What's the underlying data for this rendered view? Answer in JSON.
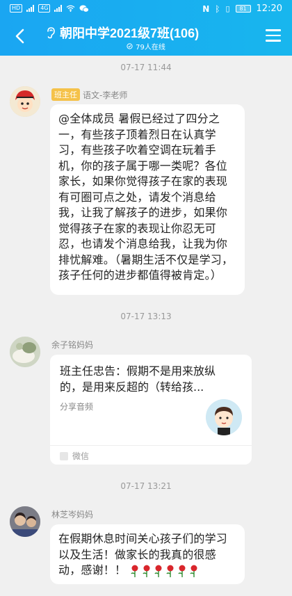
{
  "status_bar": {
    "network_left": "HD",
    "net_tag": "4G",
    "battery": "81",
    "time": "12:20"
  },
  "header": {
    "title": "朝阳中学2021级7班(106)",
    "online": "79人在线"
  },
  "messages": [
    {
      "timestamp": "07-17 11:44",
      "role_badge": "班主任",
      "sender": "语文-李老师",
      "text": "@全体成员 暑假已经过了四分之一，有些孩子顶着烈日在认真学习，有些孩子吹着空调在玩着手机，你的孩子属于哪一类呢？各位家长，如果你觉得孩子在家的表现有可圈可点之处，请发个消息给我，让我了解孩子的进步，如果你觉得孩子在家的表现让你忍无可忍，也请发个消息给我，让我为你排忧解难。（暑期生活不仅是学习，孩子任何的进步都值得被肯定。）"
    },
    {
      "timestamp": "07-17 13:13",
      "sender": "余子铭妈妈",
      "card_title": "班主任忠告：假期不是用来放纵的，是用来反超的（转给孩...",
      "card_label": "分享音频",
      "card_source": "微信"
    },
    {
      "timestamp": "07-17 13:21",
      "sender": "林芝岑妈妈",
      "text": "在假期休息时间关心孩子们的学习以及生活！做家长的我真的很感动，感谢！！"
    }
  ],
  "icons": {
    "back": "chevron-left-icon",
    "menu": "hamburger-menu-icon",
    "group": "ear-icon",
    "online": "online-dot-icon",
    "rose": "rose-emoji"
  },
  "colors": {
    "header": "#1aa6f2",
    "role_badge": "#f5c24a",
    "rose": "#d9262c"
  }
}
